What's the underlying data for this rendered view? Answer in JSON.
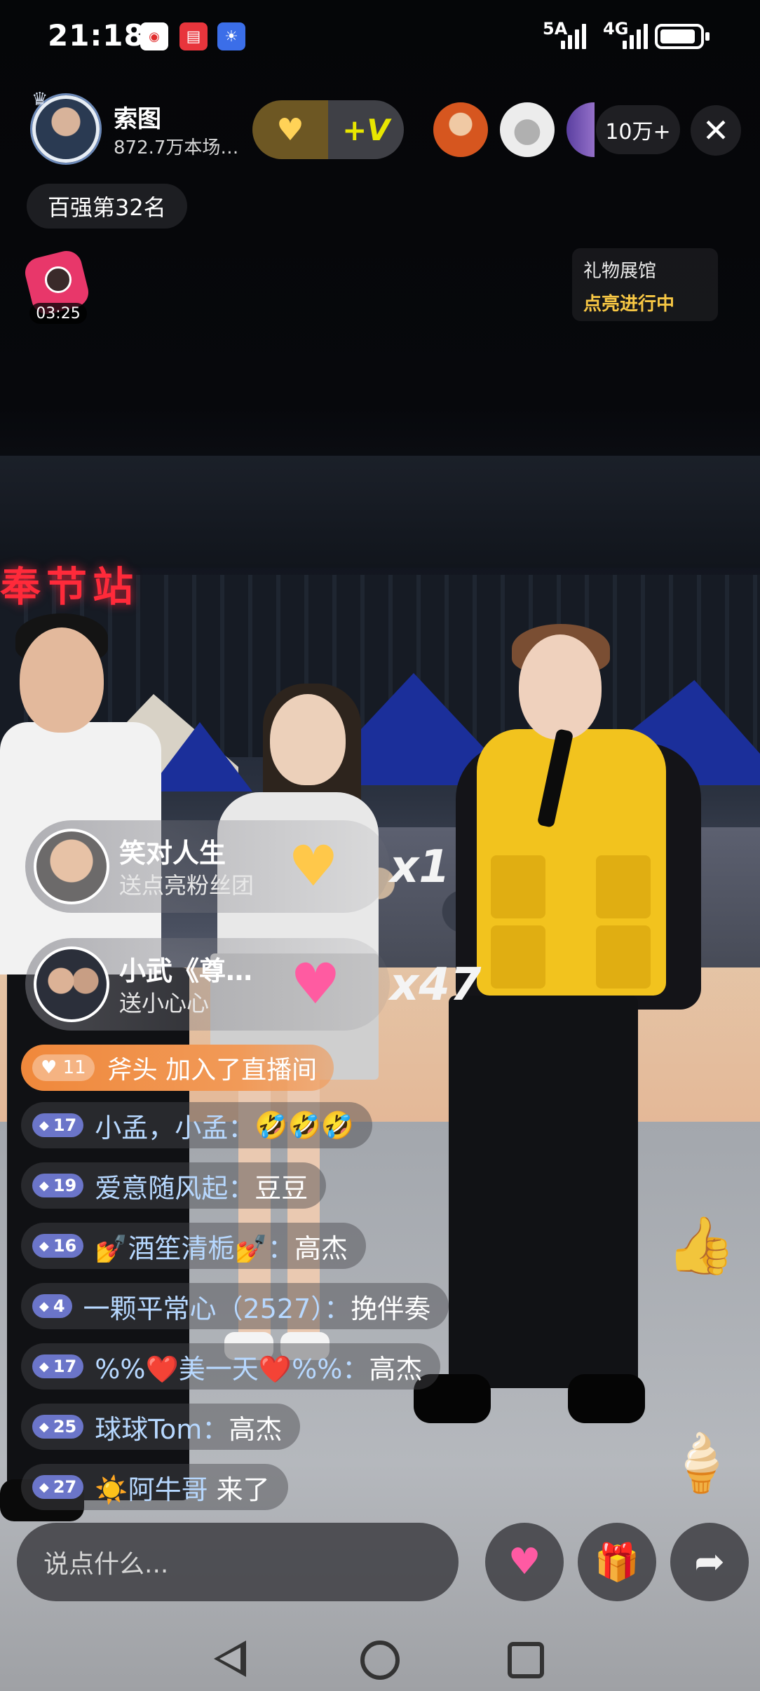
{
  "status_bar": {
    "time": "21:18",
    "network_1": "5A",
    "network_2": "4G",
    "battery_level": 0.9
  },
  "host": {
    "name": "索图",
    "subtitle": "872.7万本场…",
    "rank": "百强第32名"
  },
  "viewer_count": "10万+",
  "red_packet_timer": "03:25",
  "gift_hall": {
    "title": "礼物展馆",
    "status": "点亮进行中"
  },
  "background": {
    "station_sign": "奉节站"
  },
  "gifts": [
    {
      "user": "笑对人生",
      "action": "送点亮粉丝团",
      "count": "x1",
      "icon": "golden-heart-icon"
    },
    {
      "user": "小武《尊…",
      "action": "送小心心",
      "count": "x47",
      "icon": "pink-heart-icon"
    }
  ],
  "join": {
    "level": "11",
    "user": "斧头",
    "text": "加入了直播间"
  },
  "chat": [
    {
      "level": "17",
      "user": "小孟，小孟：",
      "text": "🤣🤣🤣"
    },
    {
      "level": "19",
      "user": "爱意随风起：",
      "text": "豆豆"
    },
    {
      "level": "16",
      "user": "💅酒笙清栀💅：",
      "text": "高杰"
    },
    {
      "level": "4",
      "user": "一颗平常心（2527）：",
      "text": "挽伴奏"
    },
    {
      "level": "17",
      "user": "%%❤️美一天❤️%%：",
      "text": "高杰"
    },
    {
      "level": "25",
      "user": "球球Tom：",
      "text": "高杰"
    },
    {
      "level": "27",
      "user": "☀️阿牛哥",
      "text": "来了"
    }
  ],
  "input": {
    "placeholder": "说点什么..."
  },
  "colors": {
    "accent_gold": "#f7c744",
    "join_orange": "#f0883b",
    "level_purple": "#6b75c9"
  }
}
